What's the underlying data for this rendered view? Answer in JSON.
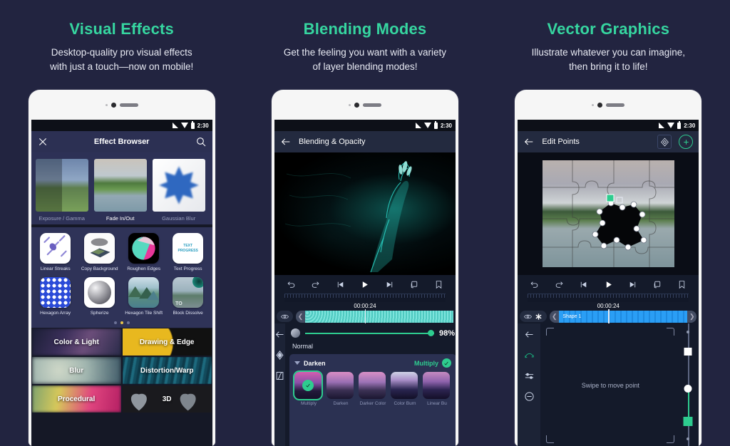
{
  "background_color": "#222440",
  "accent_color": "#36d6a0",
  "panels": [
    {
      "heading": "Visual Effects",
      "subheading_line1": "Desktop-quality pro visual effects",
      "subheading_line2": "with just a touch—now on mobile!",
      "status_bar": {
        "time": "2:30"
      },
      "appbar": {
        "close_icon": "close-icon",
        "title": "Effect Browser",
        "search_icon": "search-icon"
      },
      "featured": [
        {
          "label": "Exposure / Gamma"
        },
        {
          "label": "Fade In/Out"
        },
        {
          "label": "Gaussian Blur"
        }
      ],
      "grid": [
        {
          "label": "Linear Streaks"
        },
        {
          "label": "Copy Background"
        },
        {
          "label": "Roughen Edges"
        },
        {
          "label": "Text Progress"
        },
        {
          "label": "Hexagon Array"
        },
        {
          "label": "Spherize"
        },
        {
          "label": "Hexagon Tile Shift"
        },
        {
          "label": "Block Dissolve"
        }
      ],
      "pager": {
        "count": 3,
        "active": 1
      },
      "categories": [
        [
          "Color & Light",
          "Drawing & Edge"
        ],
        [
          "Blur",
          "Distortion/Warp"
        ],
        [
          "Procedural",
          "3D"
        ]
      ]
    },
    {
      "heading": "Blending Modes",
      "subheading_line1": "Get the feeling you want with a variety",
      "subheading_line2": "of layer blending modes!",
      "status_bar": {
        "time": "2:30"
      },
      "appbar": {
        "back_icon": "back-arrow-icon",
        "title": "Blending & Opacity"
      },
      "transport": [
        "undo-icon",
        "redo-icon",
        "skip-start-icon",
        "play-icon",
        "skip-end-icon",
        "loop-icon",
        "bookmark-icon"
      ],
      "timecode": "00:00:24",
      "track": {
        "visibility_icon": "eye-icon",
        "clip_type": "audio"
      },
      "opacity": {
        "value": "98%",
        "percent": 98
      },
      "blend_current": "Normal",
      "blend_group": "Darken",
      "blend_selected": "Multiply",
      "blend_options": [
        {
          "label": "Multiply",
          "selected": true
        },
        {
          "label": "Darken",
          "selected": false
        },
        {
          "label": "Darker Color",
          "selected": false
        },
        {
          "label": "Color Burn",
          "selected": false
        },
        {
          "label": "Linear Bu",
          "selected": false
        }
      ],
      "left_rail": [
        "back-arrow-icon",
        "keyframe-diamond-icon",
        "transform-icon"
      ]
    },
    {
      "heading": "Vector Graphics",
      "subheading_line1": "Illustrate whatever you can imagine,",
      "subheading_line2": "then bring it to life!",
      "status_bar": {
        "time": "2:30"
      },
      "appbar": {
        "back_icon": "back-arrow-icon",
        "title": "Edit Points",
        "action1_icon": "node-diamond-icon",
        "action2_icon": "add-circle-icon"
      },
      "transport": [
        "undo-icon",
        "redo-icon",
        "skip-start-icon",
        "play-icon",
        "skip-end-icon",
        "loop-icon",
        "bookmark-icon"
      ],
      "timecode": "00:00:24",
      "track": {
        "visibility_icon": "eye-icon",
        "mask_icon": "asterisk-icon",
        "clip_label": "Shape 1"
      },
      "hint_text": "Swipe to move point",
      "left_rail": [
        "back-arrow-icon",
        "curve-icon",
        "handles-icon",
        "remove-circle-icon"
      ]
    }
  ]
}
